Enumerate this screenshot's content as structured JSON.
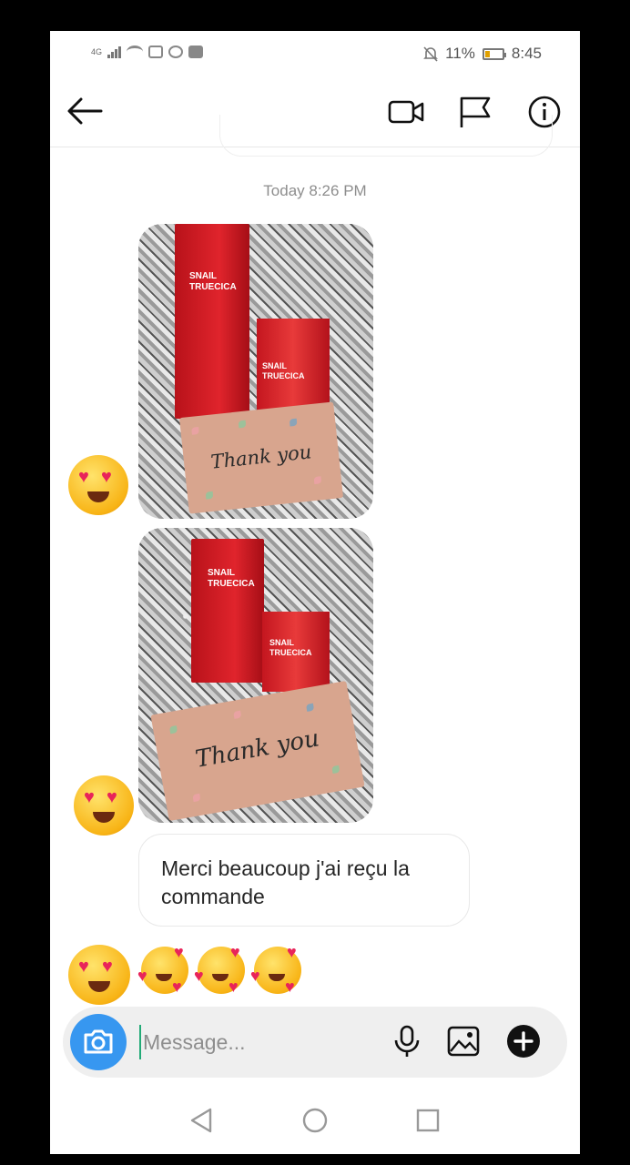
{
  "status_bar": {
    "network": "4G",
    "battery": "11%",
    "time": "8:45"
  },
  "header": {
    "contact_name": "",
    "previous_message_snippet": ""
  },
  "thread": {
    "timestamp": "Today 8:26 PM",
    "photos": [
      {
        "brand_line1": "SNAIL",
        "brand_line2": "TRUECICA",
        "box_brand_line1": "SNAIL",
        "box_brand_line2": "TRUECICA",
        "card_text": "Thank you",
        "reaction": "heart-eyes"
      },
      {
        "brand_line1": "SNAIL",
        "brand_line2": "TRUECICA",
        "box_brand_line1": "SNAIL",
        "box_brand_line2": "TRUECICA",
        "card_text": "Thank you",
        "reaction": "heart-eyes"
      }
    ],
    "message_text": "Merci beaucoup j'ai reçu la commande",
    "emoji_row": [
      "heart-eyes",
      "smiling-face-with-hearts",
      "smiling-face-with-hearts",
      "smiling-face-with-hearts"
    ]
  },
  "composer": {
    "placeholder": "Message...",
    "value": ""
  },
  "colors": {
    "accent_blue": "#3797f0",
    "timestamp_gray": "#8e8e8e",
    "product_red": "#d81e26"
  }
}
